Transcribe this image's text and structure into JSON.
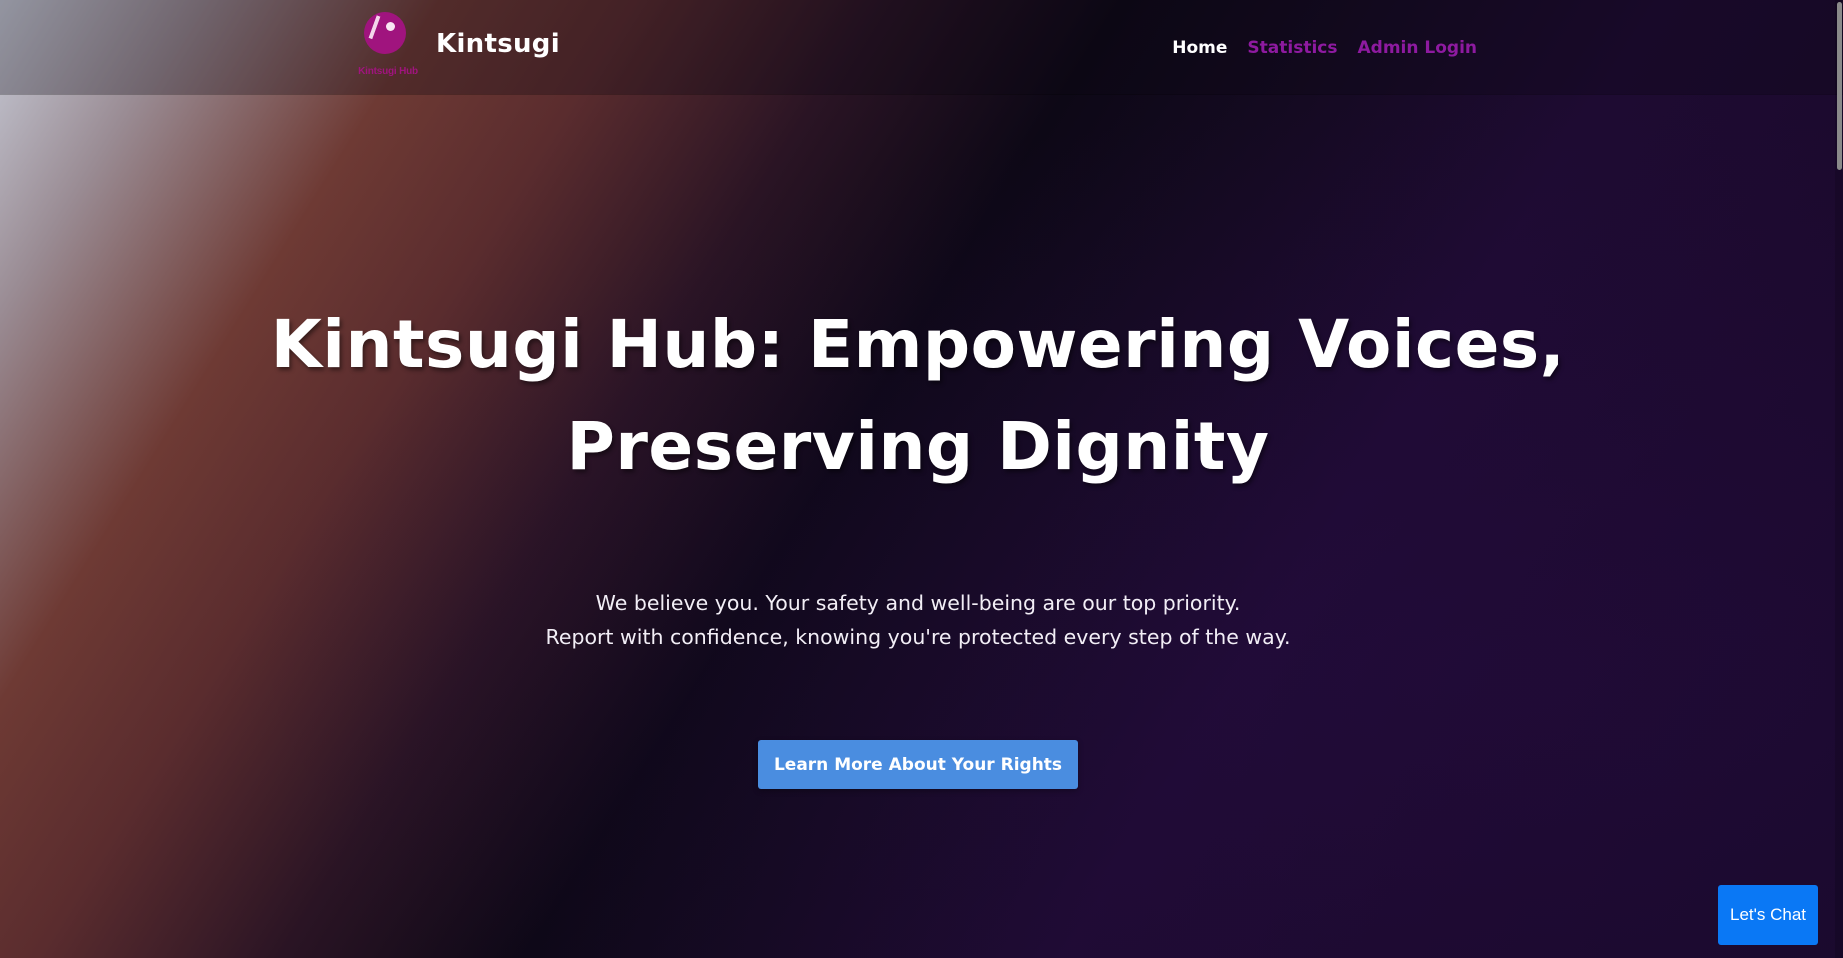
{
  "brand": {
    "logo_caption": "Kintsugi Hub",
    "name": "Kintsugi"
  },
  "nav": {
    "items": [
      {
        "label": "Home",
        "color": "#ffffff"
      },
      {
        "label": "Statistics",
        "color": "#8e1aa0"
      },
      {
        "label": "Admin Login",
        "color": "#8e1aa0"
      }
    ]
  },
  "hero": {
    "title_line1": "Kintsugi Hub: Empowering Voices,",
    "title_line2": "Preserving Dignity",
    "subtitle_line1": "We believe you. Your safety and well-being are our top priority.",
    "subtitle_line2": "Report with confidence, knowing you're protected every step of the way.",
    "cta_label": "Learn More About Your Rights"
  },
  "chat": {
    "label": "Let's Chat"
  },
  "colors": {
    "brand_magenta": "#a0147e",
    "cta_blue": "#4a8de0",
    "chat_blue": "#0a78f5"
  }
}
